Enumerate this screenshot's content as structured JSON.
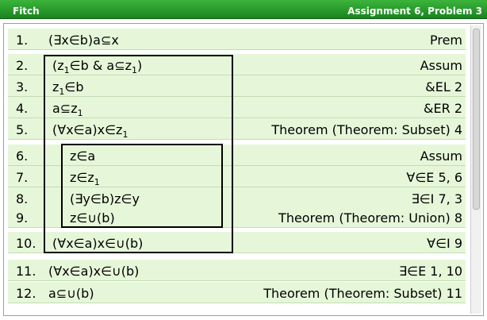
{
  "window": {
    "app": "Fitch",
    "assignment": "Assignment 6, Problem 3"
  },
  "proof": [
    {
      "num": "1.",
      "formula": [
        "(∃x∈b)a⊆x"
      ],
      "rule": "Prem"
    },
    {
      "num": "2.",
      "formula": [
        "(z",
        "1",
        "∈b & a⊆z",
        "1",
        ")"
      ],
      "rule": "Assum"
    },
    {
      "num": "3.",
      "formula": [
        "z",
        "1",
        "∈b"
      ],
      "rule": "&EL 2"
    },
    {
      "num": "4.",
      "formula": [
        "a⊆z",
        "1"
      ],
      "rule": "&ER 2"
    },
    {
      "num": "5.",
      "formula": [
        "(∀x∈a)x∈z",
        "1"
      ],
      "rule": "Theorem (Theorem: Subset) 4"
    },
    {
      "num": "6.",
      "formula": [
        "z∈a"
      ],
      "rule": "Assum"
    },
    {
      "num": "7.",
      "formula": [
        "z∈z",
        "1"
      ],
      "rule": "∀∈E 5, 6"
    },
    {
      "num": "8.",
      "formula": [
        "(∃y∈b)z∈y"
      ],
      "rule": "∃∈I 7, 3"
    },
    {
      "num": "9.",
      "formula": [
        "z∈∪(b)"
      ],
      "rule": "Theorem (Theorem: Union) 8"
    },
    {
      "num": "10.",
      "formula": [
        "(∀x∈a)x∈∪(b)"
      ],
      "rule": "∀∈I 9"
    },
    {
      "num": "11.",
      "formula": [
        "(∀x∈a)x∈∪(b)"
      ],
      "rule": "∃∈E 1, 10"
    },
    {
      "num": "12.",
      "formula": [
        "a⊆∪(b)"
      ],
      "rule": "Theorem (Theorem: Subset) 11"
    }
  ]
}
